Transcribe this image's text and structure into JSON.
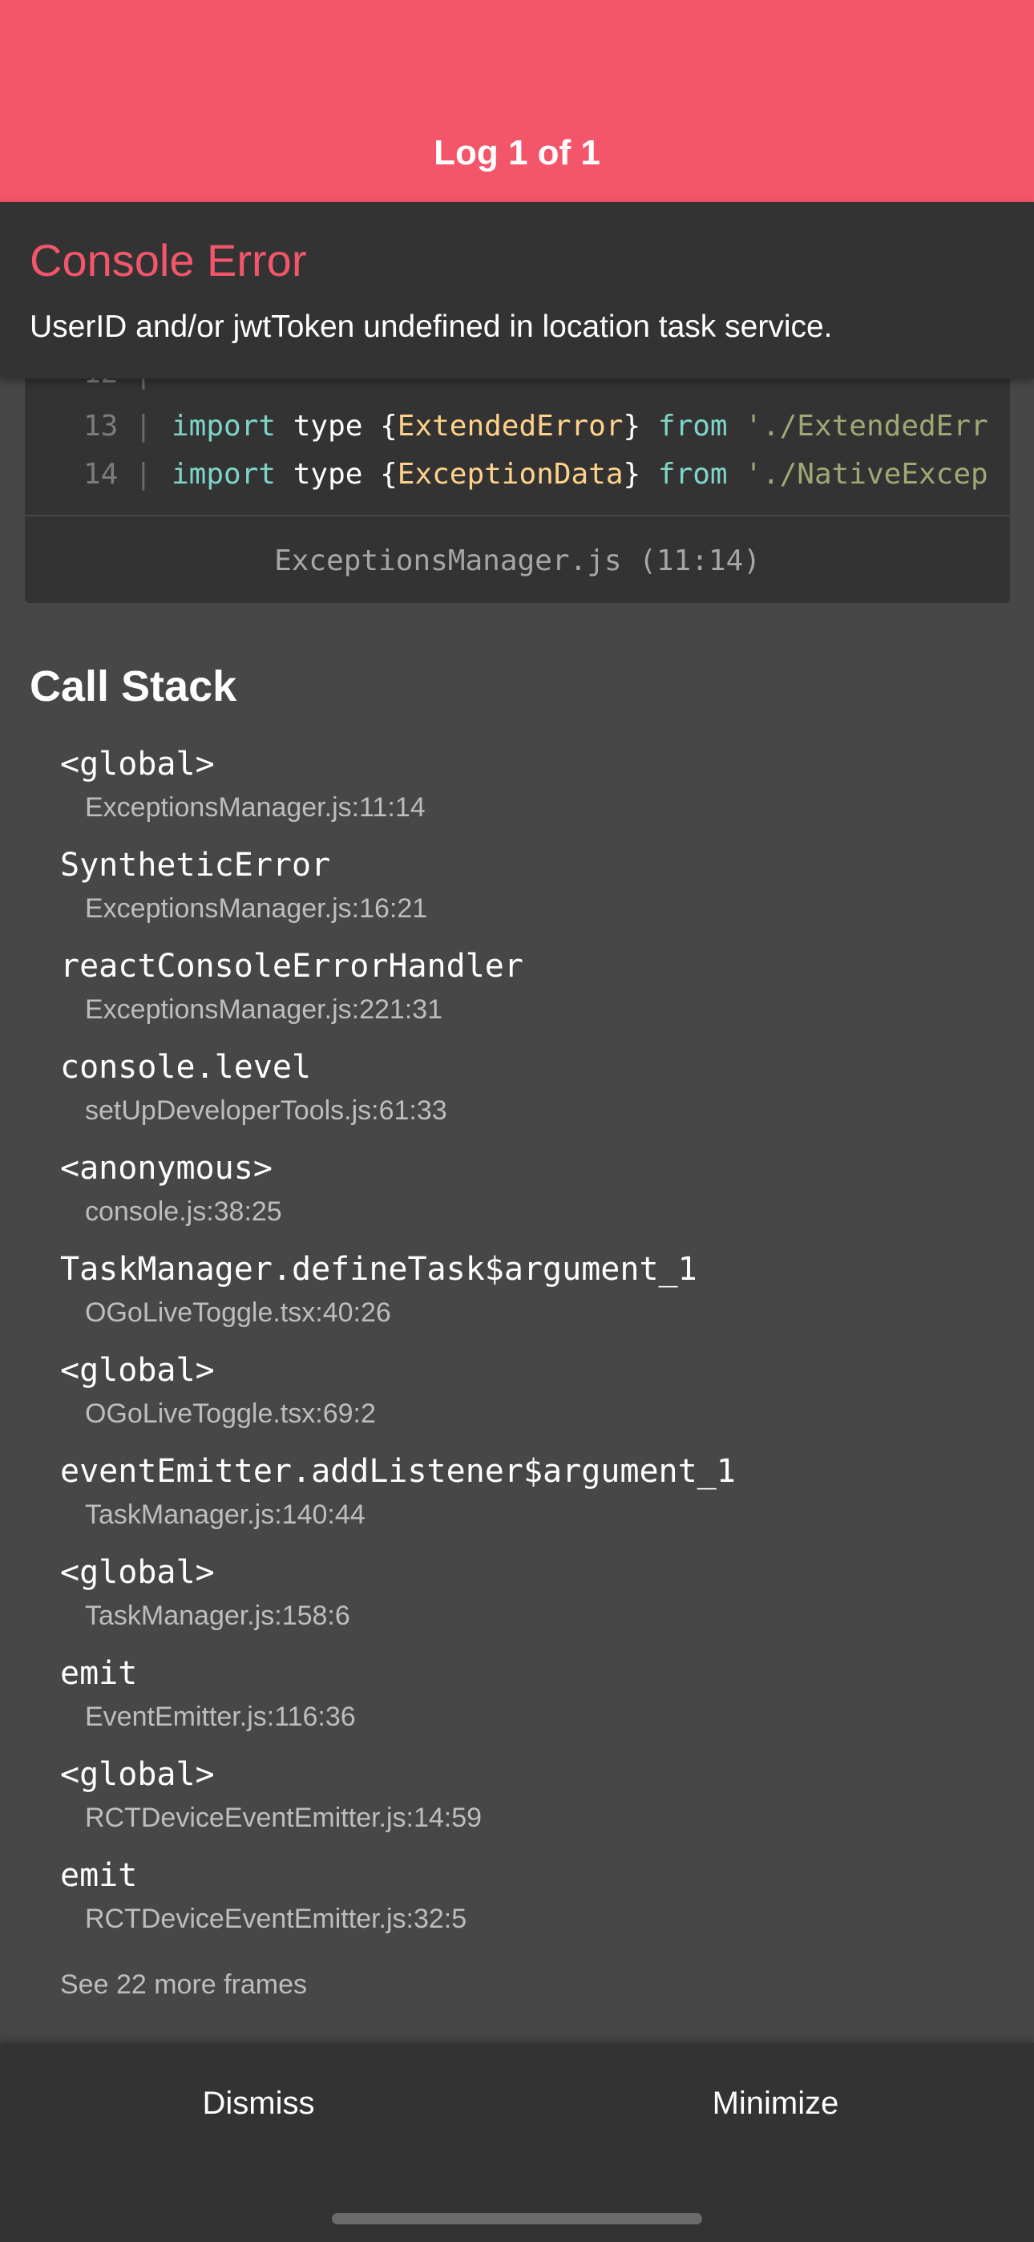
{
  "header": {
    "title": "Log 1 of 1"
  },
  "error": {
    "title": "Console Error",
    "message": "UserID and/or jwtToken undefined in location task service."
  },
  "code_frame": {
    "lines": [
      {
        "number": "13",
        "tokens": {
          "import": "import",
          "type": " type {",
          "name": "ExtendedError",
          "close": "} ",
          "from": "from",
          "path": " './ExtendedErr"
        }
      },
      {
        "number": "14",
        "tokens": {
          "import": "import",
          "type": " type {",
          "name": "ExceptionData",
          "close": "} ",
          "from": "from",
          "path": " './NativeExcep"
        }
      }
    ],
    "pipe": "|",
    "file_label": "ExceptionsManager.js (11:14)"
  },
  "call_stack": {
    "title": "Call Stack",
    "frames": [
      {
        "name": "<global>",
        "location": "ExceptionsManager.js:11:14"
      },
      {
        "name": "SyntheticError",
        "location": "ExceptionsManager.js:16:21"
      },
      {
        "name": "reactConsoleErrorHandler",
        "location": "ExceptionsManager.js:221:31"
      },
      {
        "name": "console.level",
        "location": "setUpDeveloperTools.js:61:33"
      },
      {
        "name": "<anonymous>",
        "location": "console.js:38:25"
      },
      {
        "name": "TaskManager.defineTask$argument_1",
        "location": "OGoLiveToggle.tsx:40:26"
      },
      {
        "name": "<global>",
        "location": "OGoLiveToggle.tsx:69:2"
      },
      {
        "name": "eventEmitter.addListener$argument_1",
        "location": "TaskManager.js:140:44"
      },
      {
        "name": "<global>",
        "location": "TaskManager.js:158:6"
      },
      {
        "name": "emit",
        "location": "EventEmitter.js:116:36"
      },
      {
        "name": "<global>",
        "location": "RCTDeviceEventEmitter.js:14:59"
      },
      {
        "name": "emit",
        "location": "RCTDeviceEventEmitter.js:32:5"
      }
    ],
    "see_more": "See 22 more frames"
  },
  "footer": {
    "dismiss_label": "Dismiss",
    "minimize_label": "Minimize"
  },
  "colors": {
    "accent": "#f3566a",
    "background": "#474747",
    "panel": "#333333"
  }
}
